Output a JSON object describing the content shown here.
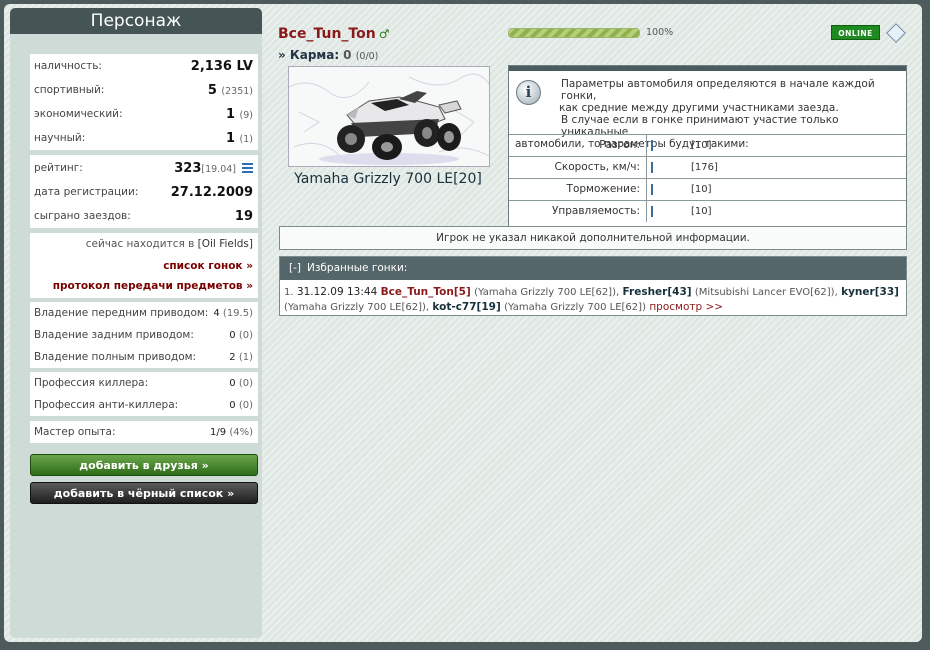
{
  "left": {
    "title": "Персонаж",
    "stats": [
      {
        "label": "наличность:",
        "value": "2,136 LV",
        "sub": ""
      },
      {
        "label": "спортивный:",
        "value": "5",
        "sub": "(2351)"
      },
      {
        "label": "экономический:",
        "value": "1",
        "sub": "(9)"
      },
      {
        "label": "научный:",
        "value": "1",
        "sub": "(1)"
      }
    ],
    "rating": {
      "label": "рейтинг:",
      "value": "323",
      "sub": "[19.04]"
    },
    "reg": {
      "label": "дата регистрации:",
      "value": "27.12.2009"
    },
    "races": {
      "label": "сыграно заездов:",
      "value": "19"
    },
    "location": {
      "prefix": "сейчас находится в",
      "place": "[Oil Fields]"
    },
    "links": {
      "races": "список гонок »",
      "protocol": "протокол передачи предметов »"
    },
    "drive": [
      {
        "label": "Владение передним приводом:",
        "value": "4",
        "sub": "(19.5)"
      },
      {
        "label": "Владение задним приводом:",
        "value": "0",
        "sub": "(0)"
      },
      {
        "label": "Владение полным приводом:",
        "value": "2",
        "sub": "(1)"
      }
    ],
    "profession": [
      {
        "label": "Профессия киллера:",
        "value": "0",
        "sub": "(0)"
      },
      {
        "label": "Профессия анти-киллера:",
        "value": "0",
        "sub": "(0)"
      }
    ],
    "master": {
      "label": "Мастер опыта:",
      "value": "1/9",
      "sub": "(4%)"
    },
    "buttons": {
      "friends": "добавить в друзья »",
      "blacklist": "добавить в чёрный список »"
    }
  },
  "profile": {
    "nick": "Bce_Tun_Ton",
    "karma_label": "» Карма:",
    "karma_value": "0",
    "karma_sub": "(0/0)",
    "progress_pct": 100,
    "progress_text": "100%",
    "status": "ONLINE"
  },
  "car": {
    "title": "Yamaha Grizzly 700 LE[20]"
  },
  "params": {
    "info1": "Параметры автомобиля определяются в начале каждой гонки,",
    "info2": "как средние между другими участниками заезда.",
    "info3": "В случае если в гонке принимают участие только уникальные",
    "info4": "автомобили, то параметры будут такими:",
    "rows": [
      {
        "label": "Разгон:",
        "value": "[10]"
      },
      {
        "label": "Скорость, км/ч:",
        "value": "[176]"
      },
      {
        "label": "Торможение:",
        "value": "[10]"
      },
      {
        "label": "Управляемость:",
        "value": "[10]"
      }
    ]
  },
  "no_info": "Игрок не указал никакой дополнительной информации.",
  "favorites": {
    "toggle": "[-]",
    "title": "Избранные гонки:",
    "entry": {
      "num": "1.",
      "datetime": "31.12.09 13:44",
      "p1": "Bce_Tun_Ton[5]",
      "c1": "(Yamaha Grizzly 700 LE[62]),",
      "p2": "Fresher[43]",
      "c2": "(Mitsubishi Lancer EVO[62]),",
      "p3": "kyner[33]",
      "c3": "(Yamaha Grizzly 700 LE[62]),",
      "p4": "kot-c77[19]",
      "c4": "(Yamaha Grizzly 700 LE[62])",
      "view": "просмотр >>"
    }
  }
}
